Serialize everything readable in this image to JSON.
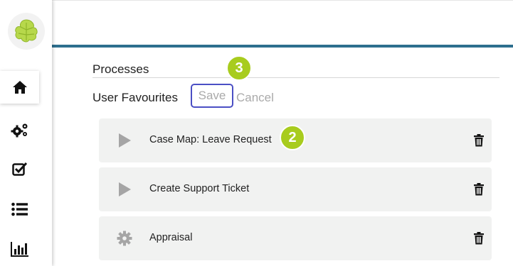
{
  "sidebar": {
    "logo": "ivy-leaf-logo",
    "items": [
      {
        "name": "home",
        "icon": "home-icon",
        "active": true
      },
      {
        "name": "processes",
        "icon": "gears-icon",
        "active": false
      },
      {
        "name": "tasks",
        "icon": "checkbox-icon",
        "active": false
      },
      {
        "name": "cases",
        "icon": "list-icon",
        "active": false
      },
      {
        "name": "statistics",
        "icon": "bar-chart-icon",
        "active": false
      }
    ]
  },
  "main": {
    "section_title": "Processes",
    "favourites_label": "User Favourites",
    "save_label": "Save",
    "cancel_label": "Cancel",
    "badges": {
      "save": "3",
      "first_row": "2"
    },
    "processes": [
      {
        "label": "Case Map: Leave Request",
        "icon": "play-icon"
      },
      {
        "label": "Create Support Ticket",
        "icon": "play-icon"
      },
      {
        "label": "Appraisal",
        "icon": "gear-icon"
      }
    ]
  },
  "colors": {
    "accent": "#2e6f8e",
    "badge": "#a8cc1e",
    "save_outline": "#4b4fc4",
    "row_background": "#f1f2f1"
  }
}
